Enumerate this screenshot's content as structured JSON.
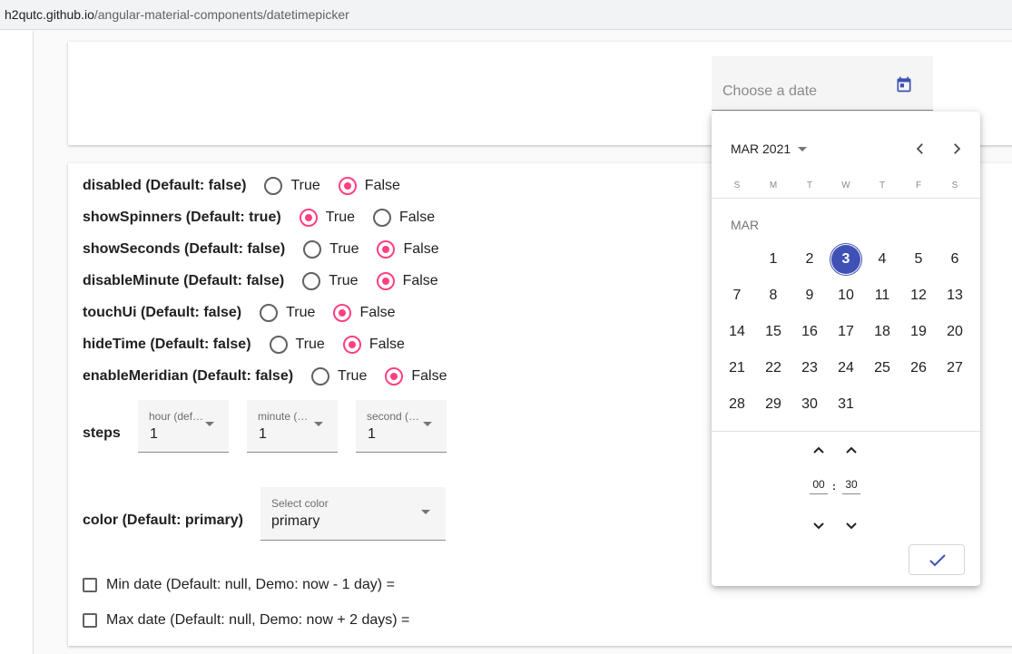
{
  "browser": {
    "url_host": "h2qutc.github.io",
    "url_path": "/angular-material-components/datetimepicker"
  },
  "date_input": {
    "placeholder": "Choose a date"
  },
  "options": [
    {
      "label": "disabled (Default: false)",
      "true_label": "True",
      "false_label": "False",
      "selected": "false"
    },
    {
      "label": "showSpinners (Default: true)",
      "true_label": "True",
      "false_label": "False",
      "selected": "true"
    },
    {
      "label": "showSeconds (Default: false)",
      "true_label": "True",
      "false_label": "False",
      "selected": "false"
    },
    {
      "label": "disableMinute (Default: false)",
      "true_label": "True",
      "false_label": "False",
      "selected": "false"
    },
    {
      "label": "touchUi (Default: false)",
      "true_label": "True",
      "false_label": "False",
      "selected": "false"
    },
    {
      "label": "hideTime (Default: false)",
      "true_label": "True",
      "false_label": "False",
      "selected": "false"
    },
    {
      "label": "enableMeridian (Default: false)",
      "true_label": "True",
      "false_label": "False",
      "selected": "false"
    }
  ],
  "steps": {
    "label": "steps",
    "hour": {
      "label": "hour (defau...",
      "value": "1"
    },
    "minute": {
      "label": "minute (def...",
      "value": "1"
    },
    "second": {
      "label": "second (def...",
      "value": "1"
    }
  },
  "color": {
    "label": "color (Default: primary)",
    "field_label": "Select color",
    "value": "primary"
  },
  "min_date": {
    "label": "Min date (Default: null, Demo: now - 1 day) =",
    "checked": false
  },
  "max_date": {
    "label": "Max date (Default: null, Demo: now + 2 days) =",
    "checked": false
  },
  "calendar": {
    "period_label": "MAR 2021",
    "weekdays": [
      "S",
      "M",
      "T",
      "W",
      "T",
      "F",
      "S"
    ],
    "month_label": "MAR",
    "first_weekday_offset": 1,
    "days": [
      "1",
      "2",
      "3",
      "4",
      "5",
      "6",
      "7",
      "8",
      "9",
      "10",
      "11",
      "12",
      "13",
      "14",
      "15",
      "16",
      "17",
      "18",
      "19",
      "20",
      "21",
      "22",
      "23",
      "24",
      "25",
      "26",
      "27",
      "28",
      "29",
      "30",
      "31"
    ],
    "selected_day": "3",
    "time": {
      "hours": "00",
      "minutes": "30",
      "separator": ":"
    }
  },
  "colors": {
    "accent": "#ff4081",
    "primary": "#3f51b5"
  },
  "icons": {
    "date_toggle": "calendar-icon",
    "prev": "chevron-left-icon",
    "next": "chevron-right-icon",
    "confirm": "check-icon"
  }
}
